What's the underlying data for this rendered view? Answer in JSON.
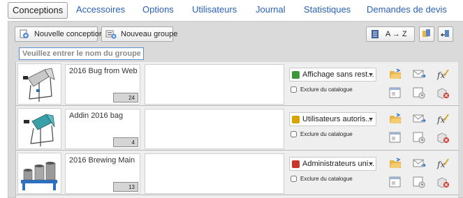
{
  "tabs": [
    {
      "label": "Conceptions",
      "active": true
    },
    {
      "label": "Accessoires"
    },
    {
      "label": "Options"
    },
    {
      "label": "Utilisateurs"
    },
    {
      "label": "Journal"
    },
    {
      "label": "Statistiques"
    },
    {
      "label": "Demandes de devis"
    }
  ],
  "toolbar": {
    "new_design_label": "Nouvelle conception",
    "new_group_label": "Nouveau groupe",
    "sort_label": "A → Z"
  },
  "search": {
    "placeholder": "Veuillez entrer le nom du groupe"
  },
  "rows": [
    {
      "name": "2016 Bug from Web",
      "count": "24",
      "visibility": "Affichage sans rest...",
      "visibility_color": "#3a9a3a",
      "exclude_label": "Exclure du catalogue"
    },
    {
      "name": "Addin 2016 bag",
      "count": "4",
      "visibility": "Utilisateurs autoris...",
      "visibility_color": "#d9a400",
      "exclude_label": "Exclure du catalogue"
    },
    {
      "name": "2016 Brewing Main",
      "count": "13",
      "visibility": "Administrateurs uni...",
      "visibility_color": "#c9362a",
      "exclude_label": "Exclure du catalogue"
    }
  ],
  "icons": {
    "row_actions": [
      "open-folder-icon",
      "send-mail-icon",
      "formula-icon",
      "window-icon",
      "schedule-icon",
      "delete-box-icon"
    ]
  }
}
